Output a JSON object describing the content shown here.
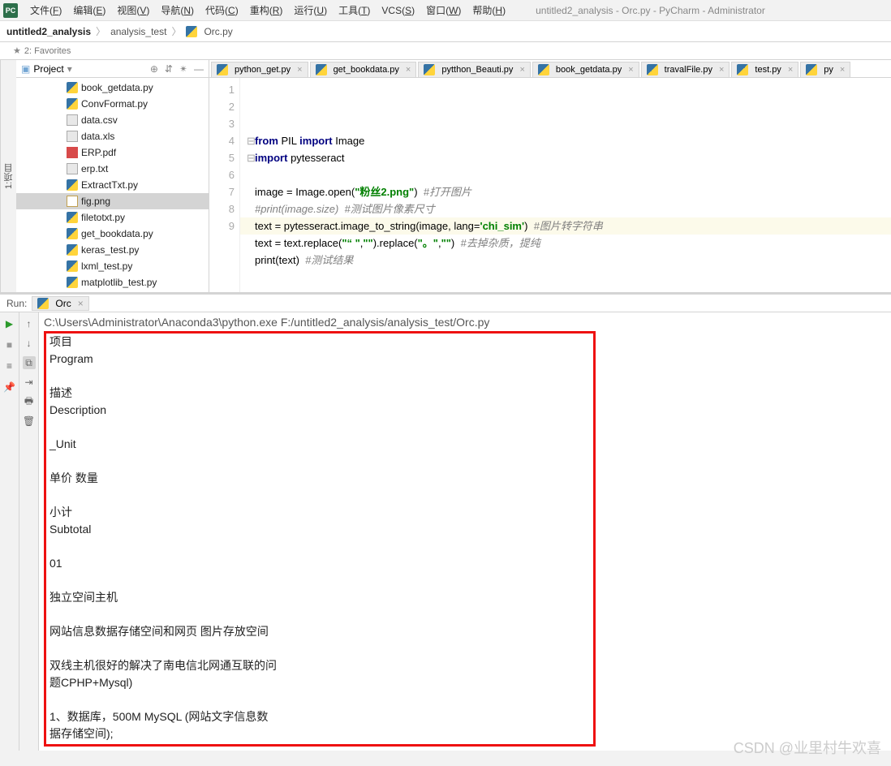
{
  "window": {
    "title": "untitled2_analysis - Orc.py - PyCharm - Administrator",
    "menus": [
      "文件(F)",
      "编辑(E)",
      "视图(V)",
      "导航(N)",
      "代码(C)",
      "重构(R)",
      "运行(U)",
      "工具(T)",
      "VCS(S)",
      "窗口(W)",
      "帮助(H)"
    ]
  },
  "breadcrumb": [
    "untitled2_analysis",
    "analysis_test",
    "Orc.py"
  ],
  "favorites": "2: Favorites",
  "left_gutter": "1:项目",
  "project_panel": {
    "title": "Project",
    "files": [
      {
        "name": "book_getdata.py",
        "kind": "py"
      },
      {
        "name": "ConvFormat.py",
        "kind": "py"
      },
      {
        "name": "data.csv",
        "kind": "txt"
      },
      {
        "name": "data.xls",
        "kind": "txt"
      },
      {
        "name": "ERP.pdf",
        "kind": "pdf"
      },
      {
        "name": "erp.txt",
        "kind": "txt"
      },
      {
        "name": "ExtractTxt.py",
        "kind": "py"
      },
      {
        "name": "fig.png",
        "kind": "png",
        "selected": true
      },
      {
        "name": "filetotxt.py",
        "kind": "py"
      },
      {
        "name": "get_bookdata.py",
        "kind": "py"
      },
      {
        "name": "keras_test.py",
        "kind": "py"
      },
      {
        "name": "lxml_test.py",
        "kind": "py"
      },
      {
        "name": "matplotlib_test.py",
        "kind": "py"
      }
    ]
  },
  "editor_tabs": [
    "python_get.py",
    "get_bookdata.py",
    "pytthon_Beauti.py",
    "book_getdata.py",
    "travalFile.py",
    "test.py",
    "py"
  ],
  "code": {
    "lines": [
      {
        "n": 1,
        "pre": "",
        "parts": [
          {
            "t": "from ",
            "c": "kw"
          },
          {
            "t": "PIL "
          },
          {
            "t": "import ",
            "c": "kw"
          },
          {
            "t": "Image"
          }
        ]
      },
      {
        "n": 2,
        "pre": "",
        "parts": [
          {
            "t": "import ",
            "c": "kw"
          },
          {
            "t": "pytesseract"
          }
        ]
      },
      {
        "n": 3,
        "pre": "",
        "parts": []
      },
      {
        "n": 4,
        "pre": "",
        "parts": [
          {
            "t": "image = Image.open("
          },
          {
            "t": "\"粉丝2.png\"",
            "c": "str"
          },
          {
            "t": ")  "
          },
          {
            "t": "#打开图片",
            "c": "cmt"
          }
        ]
      },
      {
        "n": 5,
        "pre": "",
        "parts": [
          {
            "t": "#print(image.size)  #测试图片像素尺寸",
            "c": "cmt"
          }
        ]
      },
      {
        "n": 6,
        "pre": "",
        "parts": [
          {
            "t": "text = pytesseract.image_to_string(image, "
          },
          {
            "t": "lang=",
            "c": ""
          },
          {
            "t": "'chi_sim'",
            "c": "str"
          },
          {
            "t": ")  "
          },
          {
            "t": "#图片转字符串",
            "c": "cmt"
          }
        ]
      },
      {
        "n": 7,
        "pre": "",
        "parts": [
          {
            "t": "text = text.replace("
          },
          {
            "t": "\"“ \"",
            "c": "str"
          },
          {
            "t": ","
          },
          {
            "t": "\"\"",
            "c": "str"
          },
          {
            "t": ").replace("
          },
          {
            "t": "\"。\"",
            "c": "str"
          },
          {
            "t": ","
          },
          {
            "t": "\"\"",
            "c": "str"
          },
          {
            "t": ")  "
          },
          {
            "t": "#去掉杂质，提纯",
            "c": "cmt"
          }
        ]
      },
      {
        "n": 8,
        "pre": "",
        "parts": [
          {
            "t": "print(text)  "
          },
          {
            "t": "#测试结果",
            "c": "cmt"
          }
        ]
      },
      {
        "n": 9,
        "pre": "",
        "parts": []
      }
    ]
  },
  "run": {
    "label": "Run:",
    "tab": "Orc",
    "cmd": "C:\\Users\\Administrator\\Anaconda3\\python.exe F:/untitled2_analysis/analysis_test/Orc.py",
    "output": [
      "项目",
      "Program",
      "",
      "描述",
      "Description",
      "",
      "_Unit",
      "",
      "单价    数量",
      "",
      "小计",
      "Subtotal",
      "",
      "01",
      "",
      "独立空间主机",
      "",
      " 网站信息数据存储空间和网页 图片存放空间",
      "",
      "双线主机很好的解决了南电信北网通互联的问",
      "题CPHP+Mysql)",
      "",
      "1、数据库，500M MySQL (网站文字信息数",
      "据存储空间);"
    ]
  },
  "watermark": "CSDN @业里村牛欢喜"
}
